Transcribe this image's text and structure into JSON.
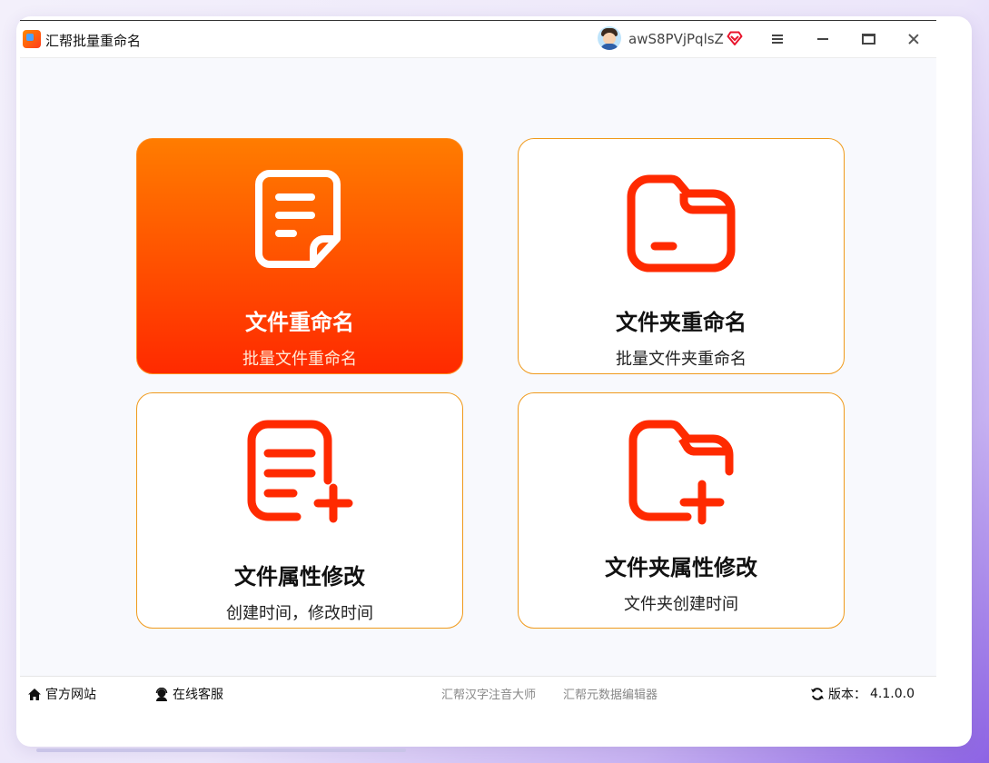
{
  "app": {
    "title": "汇帮批量重命名"
  },
  "user": {
    "name": "awS8PVjPqlsZ"
  },
  "colors": {
    "accent": "#ff5a00",
    "card_border": "#f09a1c",
    "icon_red": "#ff2a00"
  },
  "cards": [
    {
      "title": "文件重命名",
      "subtitle": "批量文件重命名",
      "icon": "document-icon",
      "selected": true
    },
    {
      "title": "文件夹重命名",
      "subtitle": "批量文件夹重命名",
      "icon": "folder-icon",
      "selected": false
    },
    {
      "title": "文件属性修改",
      "subtitle": "创建时间，修改时间",
      "icon": "document-add-icon",
      "selected": false
    },
    {
      "title": "文件夹属性修改",
      "subtitle": "文件夹创建时间",
      "icon": "folder-add-icon",
      "selected": false
    }
  ],
  "footer": {
    "website": "官方网站",
    "support": "在线客服",
    "link1": "汇帮汉字注音大师",
    "link2": "汇帮元数据编辑器",
    "version_label": "版本：",
    "version": "4.1.0.0"
  }
}
